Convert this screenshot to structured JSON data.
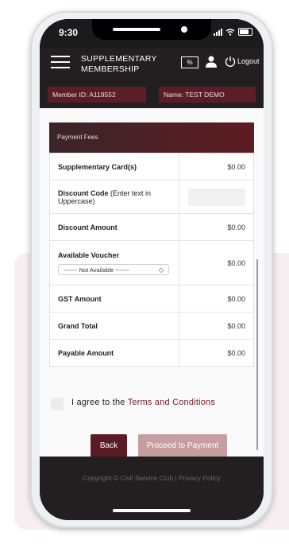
{
  "status_bar": {
    "time": "9:30"
  },
  "header": {
    "title_line1": "SUPPLEMENTARY",
    "title_line2": "MEMBERSHIP",
    "discount_icon_text": "%",
    "logout_label": "Logout"
  },
  "member": {
    "id_text": "Member ID: A119552",
    "name_text": "Name: TEST DEMO"
  },
  "payment_fees": {
    "header": "Payment Fees",
    "rows": [
      {
        "label": "Supplementary Card(s)",
        "note": "",
        "value": "$0.00"
      },
      {
        "label": "Discount Code",
        "note": " (Enter text in Uppercase)",
        "value": ""
      },
      {
        "label": "Discount Amount",
        "note": "",
        "value": "$0.00"
      },
      {
        "label": "Available Voucher",
        "note": "",
        "value": "$0.00",
        "select_value": "------- Not Available -------"
      },
      {
        "label": "GST Amount",
        "note": "",
        "value": "$0.00"
      },
      {
        "label": "Grand Total",
        "note": "",
        "value": "$0.00"
      },
      {
        "label": "Payable Amount",
        "note": "",
        "value": "$0.00"
      }
    ]
  },
  "agree": {
    "prefix": "I agree to the ",
    "link": "Terms and Conditions"
  },
  "buttons": {
    "back": "Back",
    "proceed": "Proceed to Payment"
  },
  "footer": {
    "copyright": "Copyright © Civil Service Club | Privacy Policy"
  },
  "colors": {
    "header_bg": "#231f20",
    "maroon": "#5b1b24",
    "proceed_disabled": "#c79ea0"
  }
}
